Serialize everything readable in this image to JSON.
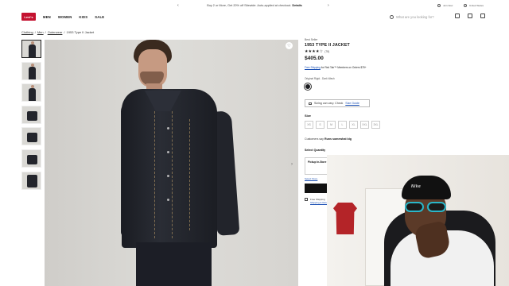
{
  "topbar": {
    "promo_text": "Buy 2 or More, Get 20% off Sitewide. Auto-applied at checkout.",
    "promo_link": "Details",
    "prev": "‹",
    "next": "›",
    "sign_in": "Join Now",
    "locale": "United States"
  },
  "header": {
    "logo": "Levi's",
    "nav": [
      "MEN",
      "WOMEN",
      "KIDS",
      "SALE"
    ],
    "search_placeholder": "What are you looking for?"
  },
  "breadcrumb": [
    "Clothing",
    "/",
    "Men",
    "/",
    "Outerwear",
    "/",
    "1953 Type II Jacket"
  ],
  "product": {
    "badge": "Best Seller",
    "name": "1953 TYPE II JACKET",
    "stars": "★★★★☆",
    "review_count": "(78)",
    "price": "$405.00",
    "shipping_text": "Free Shipping",
    "shipping_rest": "for Red Tab™ Members on Orders $75+",
    "color_label": "Original Rigid - Dark Wash",
    "sizing_text": "Sizing can vary. Check",
    "sizing_link": "Size Guide",
    "size_label": "Size",
    "sizes": [
      "XS",
      "S",
      "M",
      "L",
      "XL",
      "XXL",
      "3XL"
    ],
    "fit_prefix": "Customers say",
    "fit_value": "Runs somewhat big",
    "qty_label": "Select Quantity",
    "pickup_label": "Pickup In-Store",
    "store_link": "Select Store",
    "free_ship_label": "Free Shipping",
    "free_ship_link": "Shipping & Returns"
  },
  "webcam": {
    "beanie_text": "Nike"
  },
  "colors": {
    "brand": "#c41230",
    "link": "#1a4fb3",
    "glasses": "#2ab6c8"
  }
}
